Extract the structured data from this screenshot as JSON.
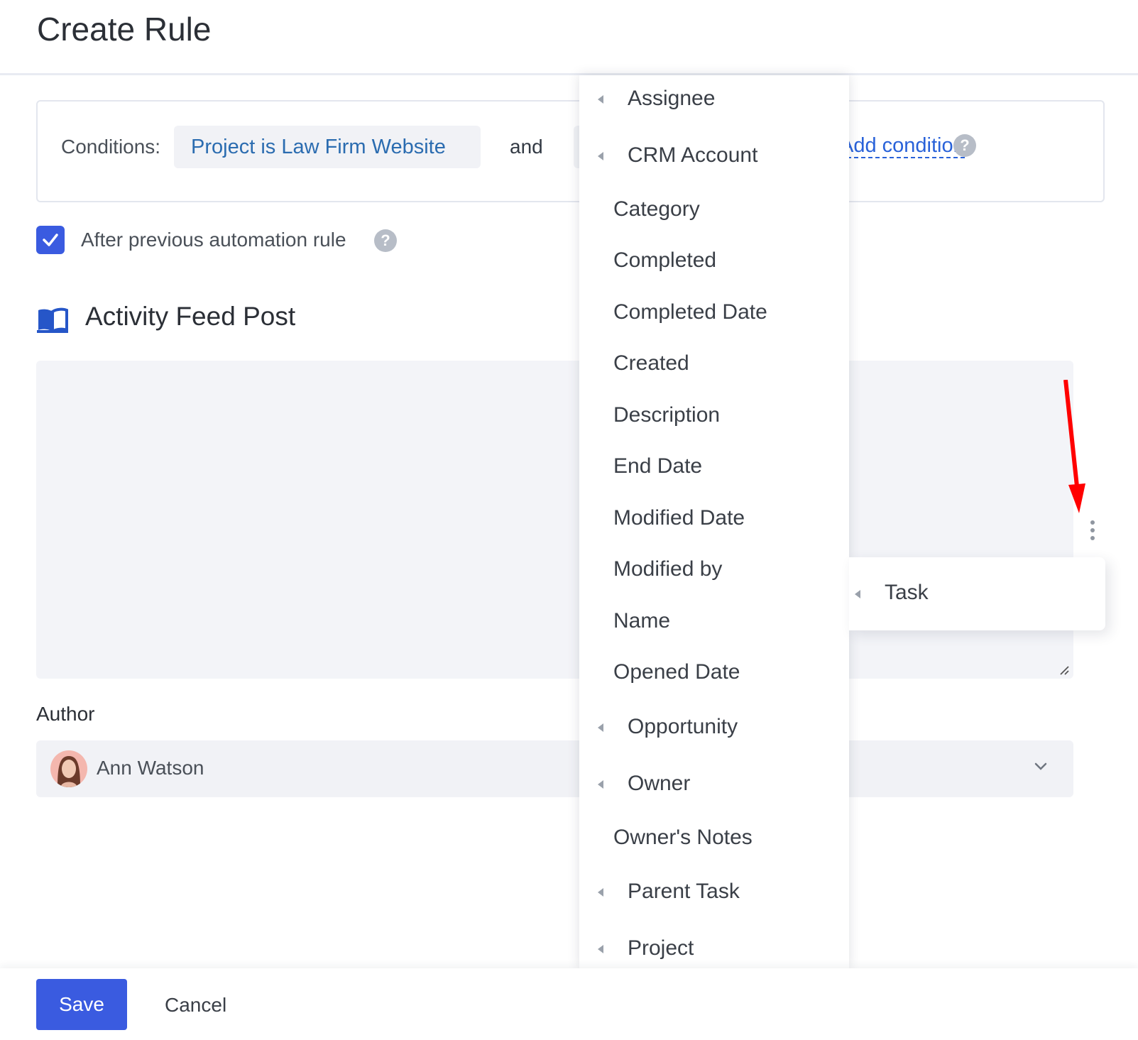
{
  "header": {
    "title": "Create Rule"
  },
  "conditions": {
    "label": "Conditions:",
    "chip": "Project is Law Firm Website",
    "joiner": "and",
    "add_link": "Add condition"
  },
  "options": {
    "after_previous_label": "After previous automation rule",
    "after_previous_checked": true
  },
  "section": {
    "title": "Activity Feed Post",
    "icon": "book-icon"
  },
  "author": {
    "label": "Author",
    "value": "Ann Watson"
  },
  "field_menu": {
    "items": [
      {
        "label": "Assignee",
        "has_submenu": true
      },
      {
        "label": "CRM Account",
        "has_submenu": true
      },
      {
        "label": "Category",
        "has_submenu": false
      },
      {
        "label": "Completed",
        "has_submenu": false
      },
      {
        "label": "Completed Date",
        "has_submenu": false
      },
      {
        "label": "Created",
        "has_submenu": false
      },
      {
        "label": "Description",
        "has_submenu": false
      },
      {
        "label": "End Date",
        "has_submenu": false
      },
      {
        "label": "Modified Date",
        "has_submenu": false
      },
      {
        "label": "Modified by",
        "has_submenu": false
      },
      {
        "label": "Name",
        "has_submenu": false
      },
      {
        "label": "Opened Date",
        "has_submenu": false
      },
      {
        "label": "Opportunity",
        "has_submenu": true
      },
      {
        "label": "Owner",
        "has_submenu": true
      },
      {
        "label": "Owner's Notes",
        "has_submenu": false
      },
      {
        "label": "Parent Task",
        "has_submenu": true
      },
      {
        "label": "Project",
        "has_submenu": true
      }
    ]
  },
  "entity_menu": {
    "items": [
      {
        "label": "Task",
        "has_submenu": true
      }
    ]
  },
  "footer": {
    "save_label": "Save",
    "cancel_label": "Cancel"
  },
  "colors": {
    "primary": "#3a5be0",
    "link": "#2962d9",
    "annotation": "#ff0000"
  }
}
